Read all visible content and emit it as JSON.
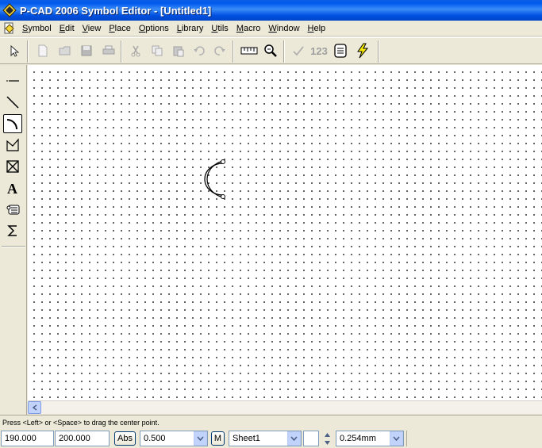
{
  "window": {
    "title": "P-CAD 2006 Symbol Editor - [Untitled1]"
  },
  "menu": [
    {
      "pre": "",
      "acc": "S",
      "post": "ymbol"
    },
    {
      "pre": "",
      "acc": "E",
      "post": "dit"
    },
    {
      "pre": "",
      "acc": "V",
      "post": "iew"
    },
    {
      "pre": "",
      "acc": "P",
      "post": "lace"
    },
    {
      "pre": "",
      "acc": "O",
      "post": "ptions"
    },
    {
      "pre": "",
      "acc": "L",
      "post": "ibrary"
    },
    {
      "pre": "",
      "acc": "U",
      "post": "tils"
    },
    {
      "pre": "",
      "acc": "M",
      "post": "acro"
    },
    {
      "pre": "",
      "acc": "W",
      "post": "indow"
    },
    {
      "pre": "",
      "acc": "H",
      "post": "elp"
    }
  ],
  "toolbar": {
    "counter_label": "123"
  },
  "status": {
    "message": "Press <Left> or <Space> to drag the center point."
  },
  "bottom": {
    "x_coord": "190.000",
    "y_coord": "200.000",
    "abs_label": "Abs",
    "grid_value": "0.500",
    "m_label": "M",
    "sheet_value": "Sheet1",
    "width_value": "0.254mm"
  },
  "colors": {
    "title_bar": "#0058ee",
    "canvas": "#ffffff",
    "chrome": "#ece9d8"
  },
  "icons": [
    "pointer-icon",
    "new-icon",
    "open-icon",
    "save-icon",
    "print-icon",
    "cut-icon",
    "copy-icon",
    "paste-icon",
    "undo-icon",
    "redo-icon",
    "ruler-icon",
    "zoom-icon",
    "check-icon",
    "number-icon",
    "layers-icon",
    "lightning-icon"
  ]
}
